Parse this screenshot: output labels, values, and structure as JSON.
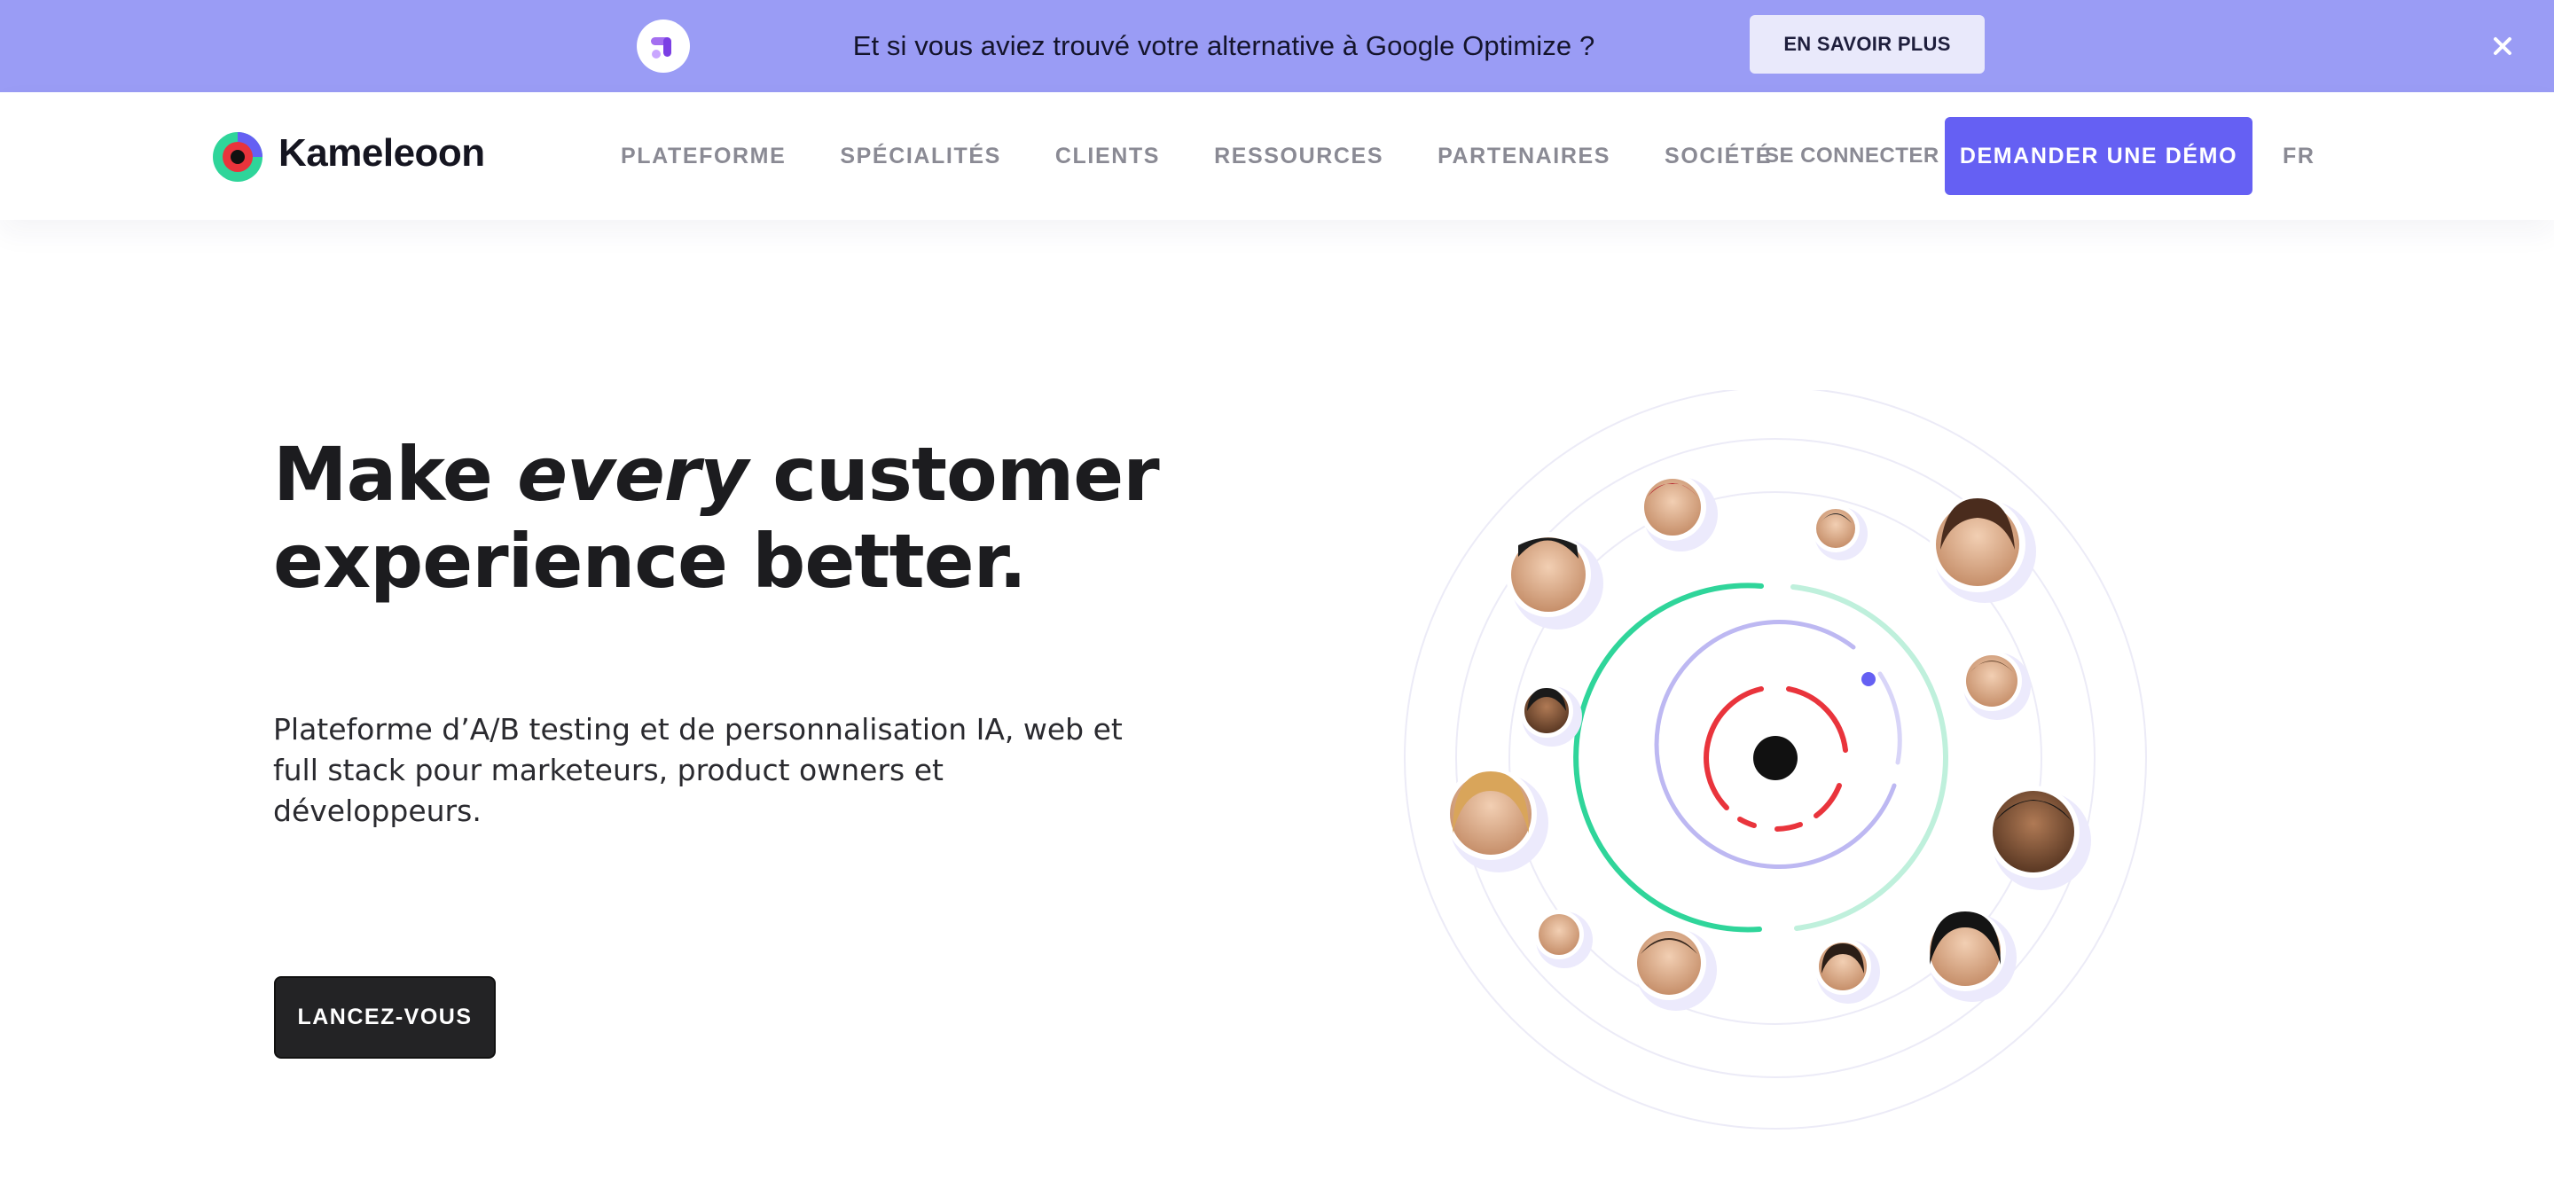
{
  "banner": {
    "logo_icon": "google-optimize-logo-icon",
    "text": "Et si vous aviez trouvé votre alternative à Google Optimize ?",
    "cta_label": "EN SAVOIR PLUS",
    "close_icon": "close-icon",
    "background_color": "#9a9cf5"
  },
  "header": {
    "brand": {
      "name": "Kameleoon",
      "logo_icon": "kameleoon-logo-icon"
    },
    "nav": [
      {
        "label": "PLATEFORME"
      },
      {
        "label": "SPÉCIALITÉS"
      },
      {
        "label": "CLIENTS"
      },
      {
        "label": "RESSOURCES"
      },
      {
        "label": "PARTENAIRES"
      },
      {
        "label": "SOCIÉTÉ"
      }
    ],
    "login_label": "SE CONNECTER",
    "demo_label": "DEMANDER UNE DÉMO",
    "language": "FR",
    "accent_color": "#6560f3"
  },
  "hero": {
    "title_part1": "Make ",
    "title_emphasis": "every",
    "title_part2": " customer",
    "title_line2": "experience better.",
    "subtitle": "Plateforme d’A/B testing et de personnalisation IA, web et full stack pour marketeurs, product owners et développeurs.",
    "cta_label": "LANCEZ-VOUS",
    "illustration": {
      "icon": "customer-orbit-illustration",
      "avatar_count": 13,
      "ring_colors": [
        "#2fd59a",
        "#b8b4f4",
        "#e9343c"
      ],
      "dot_color": "#6560f3"
    }
  }
}
